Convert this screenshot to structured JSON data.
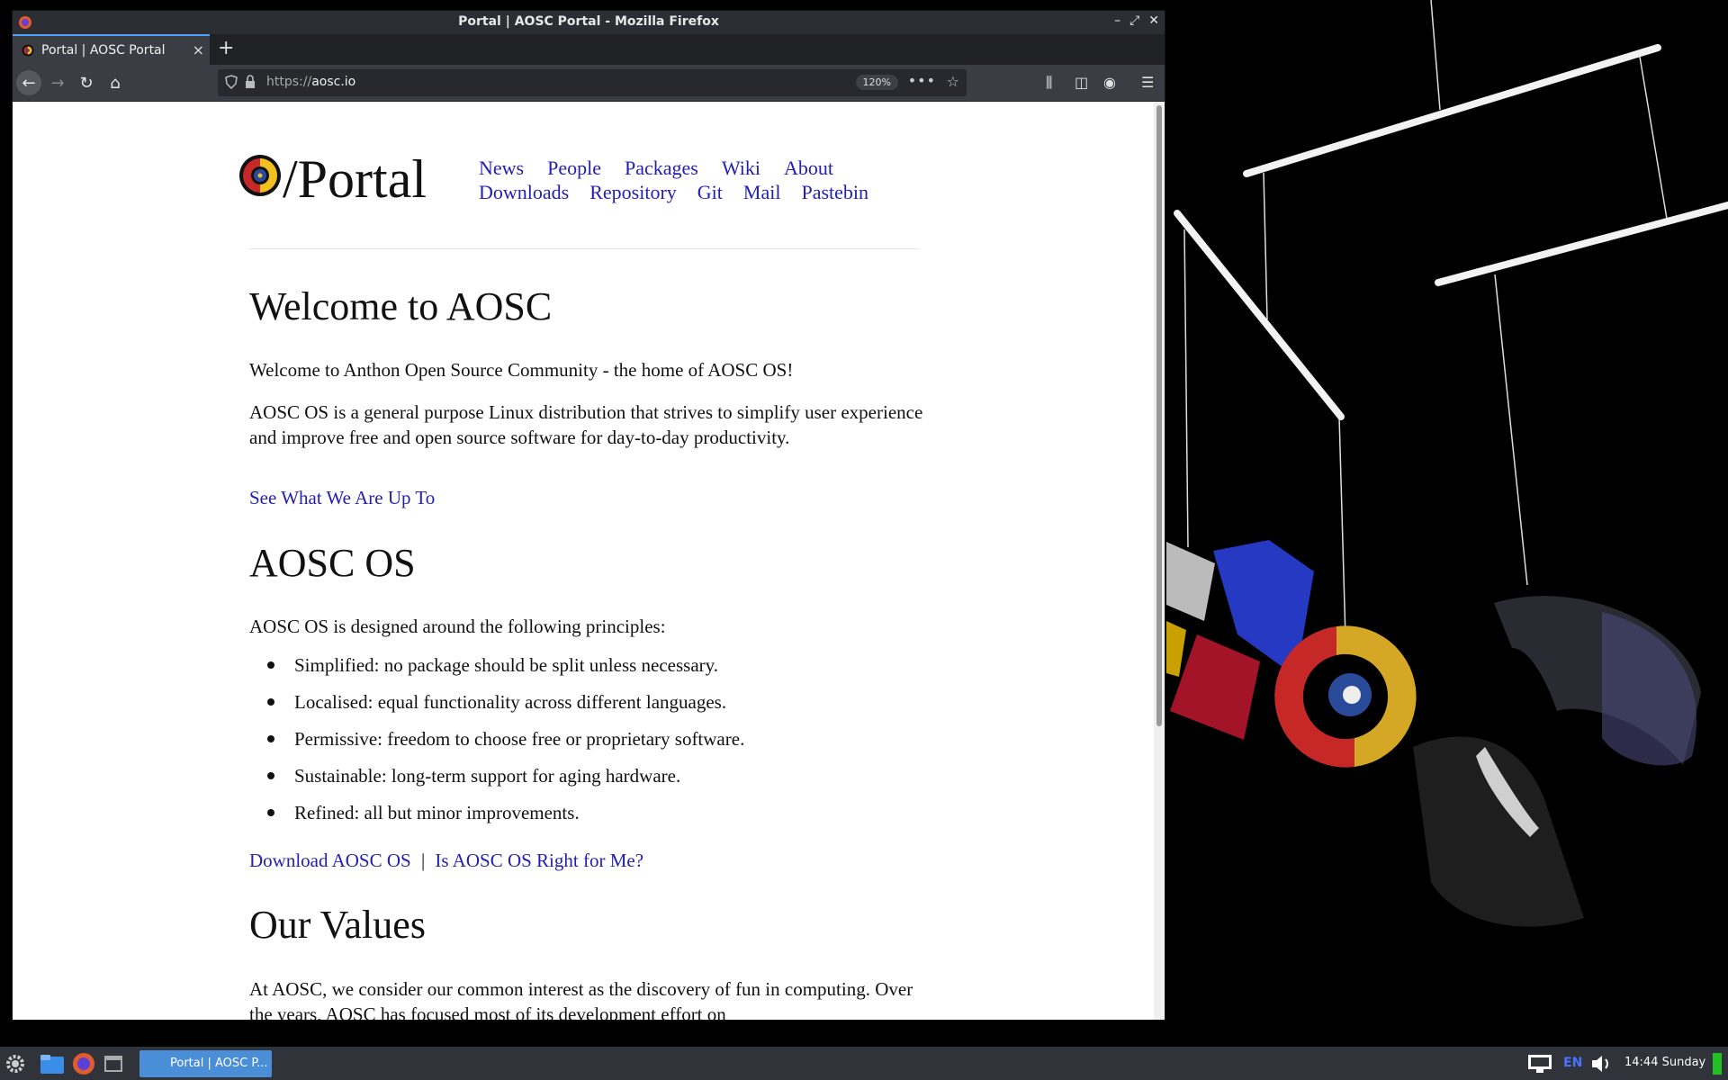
{
  "window": {
    "title": "Portal | AOSC Portal - Mozilla Firefox"
  },
  "tab": {
    "label": "Portal | AOSC Portal",
    "close": "×"
  },
  "newtab_label": "+",
  "urlbar": {
    "scheme": "https://",
    "host": "aosc.io",
    "zoom": "120%"
  },
  "site": {
    "logo_text": "/Portal",
    "nav_row1": [
      "News",
      "People",
      "Packages",
      "Wiki",
      "About"
    ],
    "nav_row2": [
      "Downloads",
      "Repository",
      "Git",
      "Mail",
      "Pastebin"
    ]
  },
  "welcome": {
    "heading": "Welcome to AOSC",
    "intro": "Welcome to Anthon Open Source Community - the home of AOSC OS!",
    "desc": "AOSC OS is a general purpose Linux distribution that strives to simplify user experience and improve free and open source software for day-to-day productivity.",
    "link": "See What We Are Up To"
  },
  "aoscos": {
    "heading": "AOSC OS",
    "intro": "AOSC OS is designed around the following principles:",
    "principles": [
      "Simplified: no package should be split unless necessary.",
      "Localised: equal functionality across different languages.",
      "Permissive: freedom to choose free or proprietary software.",
      "Sustainable: long-term support for aging hardware.",
      "Refined: all but minor improvements."
    ],
    "link_download": "Download AOSC OS",
    "separator": "|",
    "link_right": "Is AOSC OS Right for Me?"
  },
  "values": {
    "heading": "Our Values",
    "text": "At AOSC, we consider our common interest as the discovery of fun in computing. Over the years, AOSC has focused most of its development effort on"
  },
  "taskbar": {
    "window_button": "Portal | AOSC P...",
    "lang": "EN",
    "clock": "14:44 Sunday"
  },
  "colors": {
    "link": "#2520b0",
    "accent": "#4fa0ff",
    "taskbar": "#30343a"
  }
}
